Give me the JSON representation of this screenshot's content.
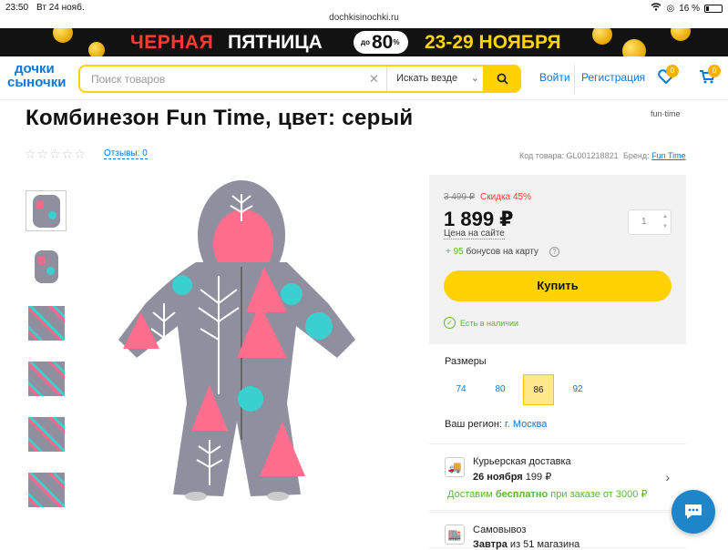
{
  "status": {
    "time": "23:50",
    "date": "Вт 24 нояб.",
    "battery": "16 %"
  },
  "browser": {
    "url": "dochkisinochki.ru"
  },
  "banner": {
    "part1": "ЧЕРНАЯ",
    "part2": "ПЯТНИЦА",
    "badge_prefix": "до",
    "badge_value": "80",
    "badge_suffix": "%",
    "dates": "23-29 НОЯБРЯ"
  },
  "header": {
    "logo_line1": "дочки",
    "logo_line2": "сыночки",
    "search_placeholder": "Поиск товаров",
    "search_scope": "Искать везде",
    "login": "Войти",
    "register": "Регистрация",
    "favorites_count": "0",
    "cart_count": "0"
  },
  "product": {
    "title": "Комбинезон Fun Time, цвет: серый",
    "brand_logo": "fun·time",
    "reviews_label": "Отзывы: 0",
    "code": "Код товара: GL001218821",
    "brand_label": "Бренд:",
    "brand_name": "Fun Time",
    "rating": 0
  },
  "pricing": {
    "old_price": "3 499 ₽",
    "discount": "Скидка 45%",
    "price": "1 899 ₽",
    "on_site": "Цена на сайте",
    "bonus_value": "+ 95",
    "bonus_text": "бонусов на карту",
    "qty": "1",
    "buy_label": "Купить",
    "stock": "Есть в наличии"
  },
  "sizes": {
    "label": "Размеры",
    "options": [
      "74",
      "80",
      "86",
      "92"
    ],
    "selected": "86"
  },
  "region": {
    "label": "Ваш регион:",
    "value": "г. Москва"
  },
  "delivery": {
    "courier_title": "Курьерская доставка",
    "courier_date": "26 ноября",
    "courier_price": "199 ₽",
    "courier_free_prefix": "Доставим",
    "courier_free_word": "бесплатно",
    "courier_free_suffix": "при заказе от 3000 ₽",
    "pickup_title": "Самовывоз",
    "pickup_date": "Завтра",
    "pickup_rest": "из 51 магазина"
  },
  "colors": {
    "accent": "#ffd200",
    "link": "#0a77d9",
    "sale": "#ff3b2f",
    "green": "#5cb82e"
  }
}
